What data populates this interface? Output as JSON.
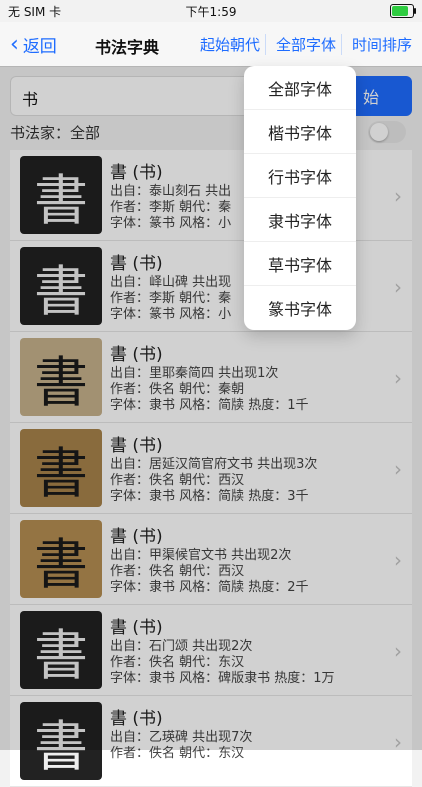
{
  "status": {
    "carrier": "无 SIM 卡",
    "time": "下午1:59"
  },
  "nav": {
    "back_label": "返回",
    "title": "书法字典",
    "action_era": "起始朝代",
    "action_font": "全部字体",
    "action_sort": "时间排序"
  },
  "search": {
    "value": "书",
    "button_label": "始"
  },
  "filter": {
    "label": "书法家：全部"
  },
  "results": [
    {
      "glyph": "書",
      "title": "書 (书)",
      "source": "出自：泰山刻石 共出",
      "author": "作者：李斯 朝代：秦",
      "style": "字体：篆书 风格：小"
    },
    {
      "glyph": "書",
      "title": "書 (书)",
      "source": "出自：峄山碑 共出现",
      "author": "作者：李斯 朝代：秦",
      "style": "字体：篆书 风格：小"
    },
    {
      "glyph": "書",
      "title": "書 (书)",
      "source": "出自：里耶秦简四 共出现1次",
      "author": "作者：佚名 朝代：秦朝",
      "style": "字体：隶书 风格：简牍 热度：1千"
    },
    {
      "glyph": "書",
      "title": "書 (书)",
      "source": "出自：居延汉简官府文书 共出现3次",
      "author": "作者：佚名 朝代：西汉",
      "style": "字体：隶书 风格：简牍 热度：3千"
    },
    {
      "glyph": "書",
      "title": "書 (书)",
      "source": "出自：甲渠候官文书 共出现2次",
      "author": "作者：佚名 朝代：西汉",
      "style": "字体：隶书 风格：简牍 热度：2千"
    },
    {
      "glyph": "書",
      "title": "書 (书)",
      "source": "出自：石门颂 共出现2次",
      "author": "作者：佚名 朝代：东汉",
      "style": "字体：隶书 风格：碑版隶书 热度：1万"
    },
    {
      "glyph": "書",
      "title": "書 (书)",
      "source": "出自：乙瑛碑 共出现7次",
      "author": "作者：佚名 朝代：东汉",
      "style": ""
    }
  ],
  "dropdown": [
    "全部字体",
    "楷书字体",
    "行书字体",
    "隶书字体",
    "草书字体",
    "篆书字体"
  ]
}
